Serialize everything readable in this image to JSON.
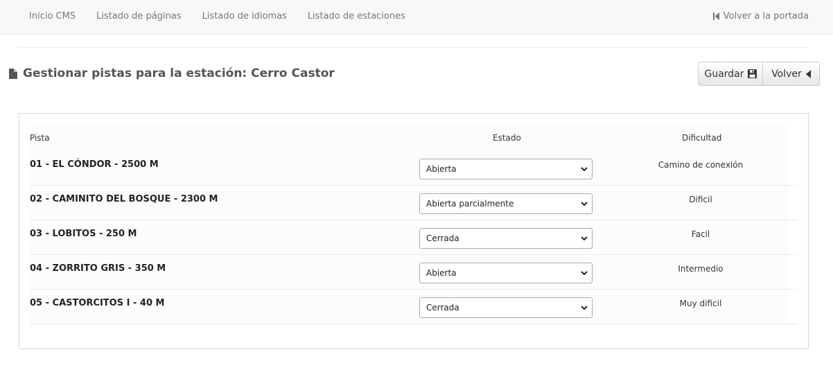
{
  "nav": {
    "links": [
      "Inicio CMS",
      "Listado de páginas",
      "Listado de idiomas",
      "Listado de estaciones"
    ],
    "back_home": "Volver a la portada"
  },
  "page": {
    "title": "Gestionar pistas para la estación: Cerro Castor"
  },
  "actions": {
    "save_label": "Guardar",
    "back_label": "Volver"
  },
  "table": {
    "headers": {
      "pista": "Pista",
      "estado": "Estado",
      "dificultad": "Dificultad"
    },
    "rows": [
      {
        "name": "01 - EL CÓNDOR - 2500 M",
        "estado": "Abierta",
        "dificultad": "Camino de conexión"
      },
      {
        "name": "02 - CAMINITO DEL BOSQUE - 2300 M",
        "estado": "Abierta parcialmente",
        "dificultad": "Dificil"
      },
      {
        "name": "03 - LOBITOS - 250 M",
        "estado": "Cerrada",
        "dificultad": "Facil"
      },
      {
        "name": "04 - ZORRITO GRIS - 350 M",
        "estado": "Abierta",
        "dificultad": "Intermedio"
      },
      {
        "name": "05 - CASTORCITOS I - 40 M",
        "estado": "Cerrada",
        "dificultad": "Muy dificil"
      }
    ]
  },
  "icons": {
    "file": "file-icon",
    "save": "floppy-disk-icon",
    "back": "caret-left-icon",
    "home_back": "step-backward-icon",
    "select": "chevron-down-icon"
  }
}
